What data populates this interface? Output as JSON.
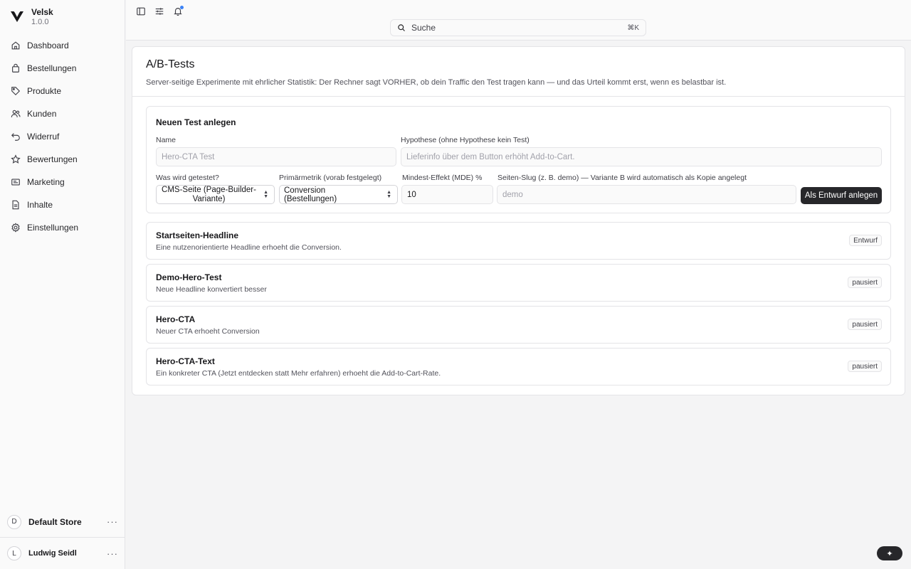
{
  "brand": {
    "name": "Velsk",
    "version": "1.0.0"
  },
  "nav": [
    {
      "label": "Dashboard",
      "icon": "home-icon"
    },
    {
      "label": "Bestellungen",
      "icon": "shopping-bag-icon"
    },
    {
      "label": "Produkte",
      "icon": "tag-icon"
    },
    {
      "label": "Kunden",
      "icon": "users-icon"
    },
    {
      "label": "Widerruf",
      "icon": "undo-icon"
    },
    {
      "label": "Bewertungen",
      "icon": "star-icon"
    },
    {
      "label": "Marketing",
      "icon": "mail-icon"
    },
    {
      "label": "Inhalte",
      "icon": "file-icon"
    },
    {
      "label": "Einstellungen",
      "icon": "gear-icon"
    }
  ],
  "store": {
    "initial": "D",
    "name": "Default Store",
    "more": "···"
  },
  "user": {
    "initial": "L",
    "name": "Ludwig Seidl",
    "more": "···"
  },
  "search": {
    "label": "Suche",
    "shortcut": "⌘K"
  },
  "page": {
    "title": "A/B-Tests",
    "subtitle": "Server-seitige Experimente mit ehrlicher Statistik: Der Rechner sagt VORHER, ob dein Traffic den Test tragen kann — und das Urteil kommt erst, wenn es belastbar ist."
  },
  "form": {
    "title": "Neuen Test anlegen",
    "name_label": "Name",
    "name_placeholder": "Hero-CTA Test",
    "hypothesis_label": "Hypothese (ohne Hypothese kein Test)",
    "hypothesis_placeholder": "Lieferinfo über dem Button erhöht Add-to-Cart.",
    "target_label": "Was wird getestet?",
    "target_value": "CMS-Seite (Page-Builder-Variante)",
    "metric_label": "Primärmetrik (vorab festgelegt)",
    "metric_value": "Conversion (Bestellungen)",
    "mde_label": "Mindest-Effekt (MDE) %",
    "mde_value": "10",
    "slug_label": "Seiten-Slug (z. B. demo) — Variante B wird automatisch als Kopie angelegt",
    "slug_placeholder": "demo",
    "submit_label": "Als Entwurf anlegen"
  },
  "tests": [
    {
      "name": "Startseiten-Headline",
      "hypothesis": "Eine nutzenorientierte Headline erhoeht die Conversion.",
      "status": "Entwurf"
    },
    {
      "name": "Demo-Hero-Test",
      "hypothesis": "Neue Headline konvertiert besser",
      "status": "pausiert"
    },
    {
      "name": "Hero-CTA",
      "hypothesis": "Neuer CTA erhoeht Conversion",
      "status": "pausiert"
    },
    {
      "name": "Hero-CTA-Text",
      "hypothesis": "Ein konkreter CTA (Jetzt entdecken statt Mehr erfahren) erhoeht die Add-to-Cart-Rate.",
      "status": "pausiert"
    }
  ],
  "fab": {
    "label": "✦",
    "icon": "sparkle-icon"
  }
}
